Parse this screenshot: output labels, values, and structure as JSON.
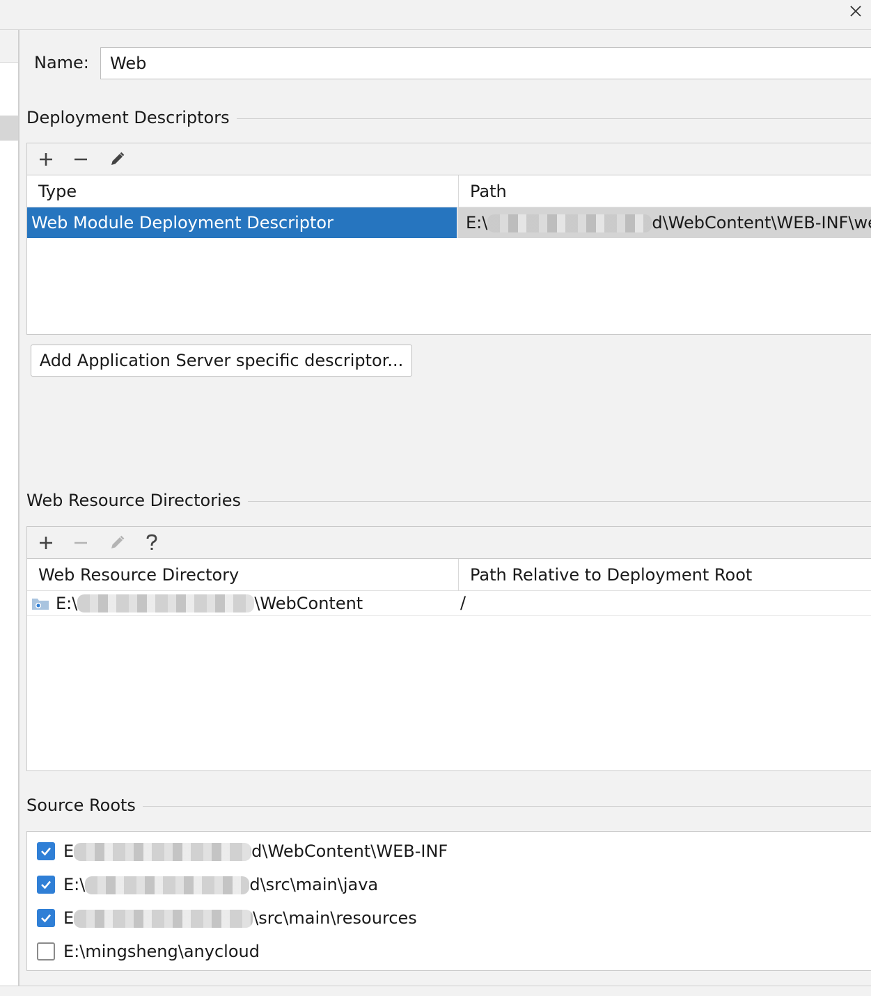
{
  "window": {
    "close_icon": "close-icon"
  },
  "name_field": {
    "label": "Name:",
    "value": "Web"
  },
  "deployment_descriptors": {
    "title": "Deployment Descriptors",
    "columns": [
      "Type",
      "Path"
    ],
    "rows": [
      {
        "type": "Web Module Deployment Descriptor",
        "path_prefix": "E:\\",
        "path_suffix": "d\\WebContent\\WEB-INF\\we"
      }
    ],
    "add_server_button": "Add Application Server specific descriptor..."
  },
  "web_resource_directories": {
    "title": "Web Resource Directories",
    "columns": [
      "Web Resource Directory",
      "Path Relative to Deployment Root"
    ],
    "rows": [
      {
        "dir_prefix": "E:\\",
        "dir_suffix": "\\WebContent",
        "relative": "/"
      }
    ]
  },
  "source_roots": {
    "title": "Source Roots",
    "items": [
      {
        "prefix": "E",
        "suffix": "d\\WebContent\\WEB-INF",
        "checked": true
      },
      {
        "prefix": "E:\\",
        "suffix": "d\\src\\main\\java",
        "checked": true
      },
      {
        "prefix": "E",
        "suffix": "\\src\\main\\resources",
        "checked": true
      },
      {
        "prefix": "E:\\mingsheng\\anycloud",
        "suffix": "",
        "checked": false
      }
    ]
  },
  "colors": {
    "selection": "#2675bf",
    "checkbox": "#2f7fd6"
  }
}
